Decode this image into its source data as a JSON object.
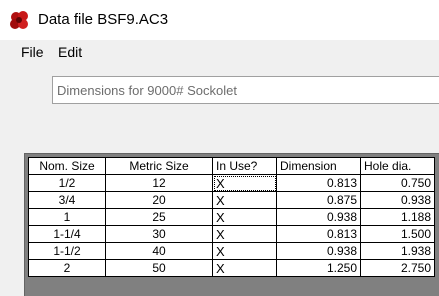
{
  "window": {
    "title": "Data file BSF9.AC3",
    "icon": "app-icon-red-flower"
  },
  "menu": {
    "items": [
      "File",
      "Edit"
    ]
  },
  "description": {
    "value": "Dimensions for 9000# Sockolet"
  },
  "table": {
    "headers": [
      "Nom. Size",
      "Metric Size",
      "In Use?",
      "Dimension",
      "Hole dia."
    ],
    "rows": [
      [
        "1/2",
        "12",
        "X",
        "0.813",
        "0.750"
      ],
      [
        "3/4",
        "20",
        "X",
        "0.875",
        "0.938"
      ],
      [
        "1",
        "25",
        "X",
        "0.938",
        "1.188"
      ],
      [
        "1-1/4",
        "30",
        "X",
        "0.813",
        "1.500"
      ],
      [
        "1-1/2",
        "40",
        "X",
        "0.938",
        "1.938"
      ],
      [
        "2",
        "50",
        "X",
        "1.250",
        "2.750"
      ]
    ]
  }
}
